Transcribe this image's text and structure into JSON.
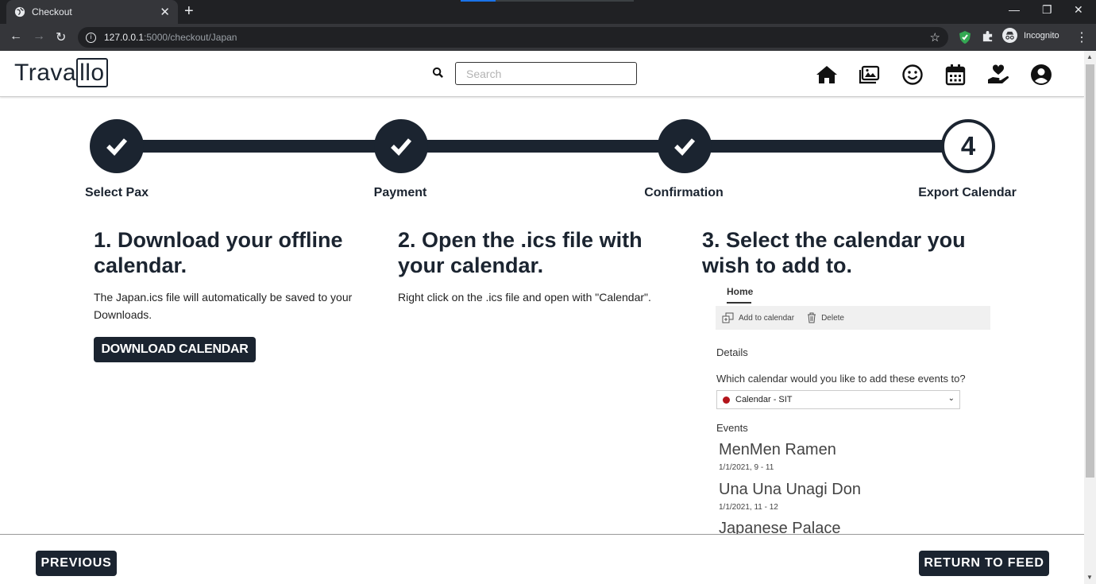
{
  "browser": {
    "tab_title": "Checkout",
    "url_host": "127.0.0.1",
    "url_path": ":5000/checkout/Japan",
    "profile_label": "Incognito"
  },
  "header": {
    "logo_text_a": "Trava",
    "logo_text_b": "llo",
    "search_placeholder": "Search",
    "nav_icons": [
      "home-icon",
      "gallery-icon",
      "smile-icon",
      "calendar-icon",
      "donate-icon",
      "account-icon"
    ]
  },
  "stepper": {
    "steps": [
      {
        "label": "Select Pax",
        "status": "done"
      },
      {
        "label": "Payment",
        "status": "done"
      },
      {
        "label": "Confirmation",
        "status": "done"
      },
      {
        "label": "Export Calendar",
        "status": "current",
        "number": "4"
      }
    ]
  },
  "columns": [
    {
      "title": "1. Download your offline calendar.",
      "text": "The Japan.ics file will automatically be saved to your Downloads.",
      "button": "DOWNLOAD CALENDAR"
    },
    {
      "title": "2. Open the .ics file with your calendar.",
      "text": "Right click on the .ics file and open with \"Calendar\"."
    },
    {
      "title": "3. Select the calendar you wish to add to."
    }
  ],
  "calendar_preview": {
    "tab": "Home",
    "toolbar": {
      "add": "Add to calendar",
      "delete": "Delete"
    },
    "details_label": "Details",
    "question": "Which calendar would you like to add these events to?",
    "selected_calendar": "Calendar - SIT",
    "calendar_color": "#b3141b",
    "events_label": "Events",
    "events": [
      {
        "name": "MenMen Ramen",
        "time": "1/1/2021, 9 - 11"
      },
      {
        "name": "Una Una Unagi Don",
        "time": "1/1/2021, 11 - 12"
      },
      {
        "name": "Japanese Palace",
        "time": ""
      }
    ]
  },
  "footer": {
    "previous": "PREVIOUS",
    "return_to_feed": "RETURN TO FEED"
  },
  "colors": {
    "brand_dark": "#1b2430"
  }
}
